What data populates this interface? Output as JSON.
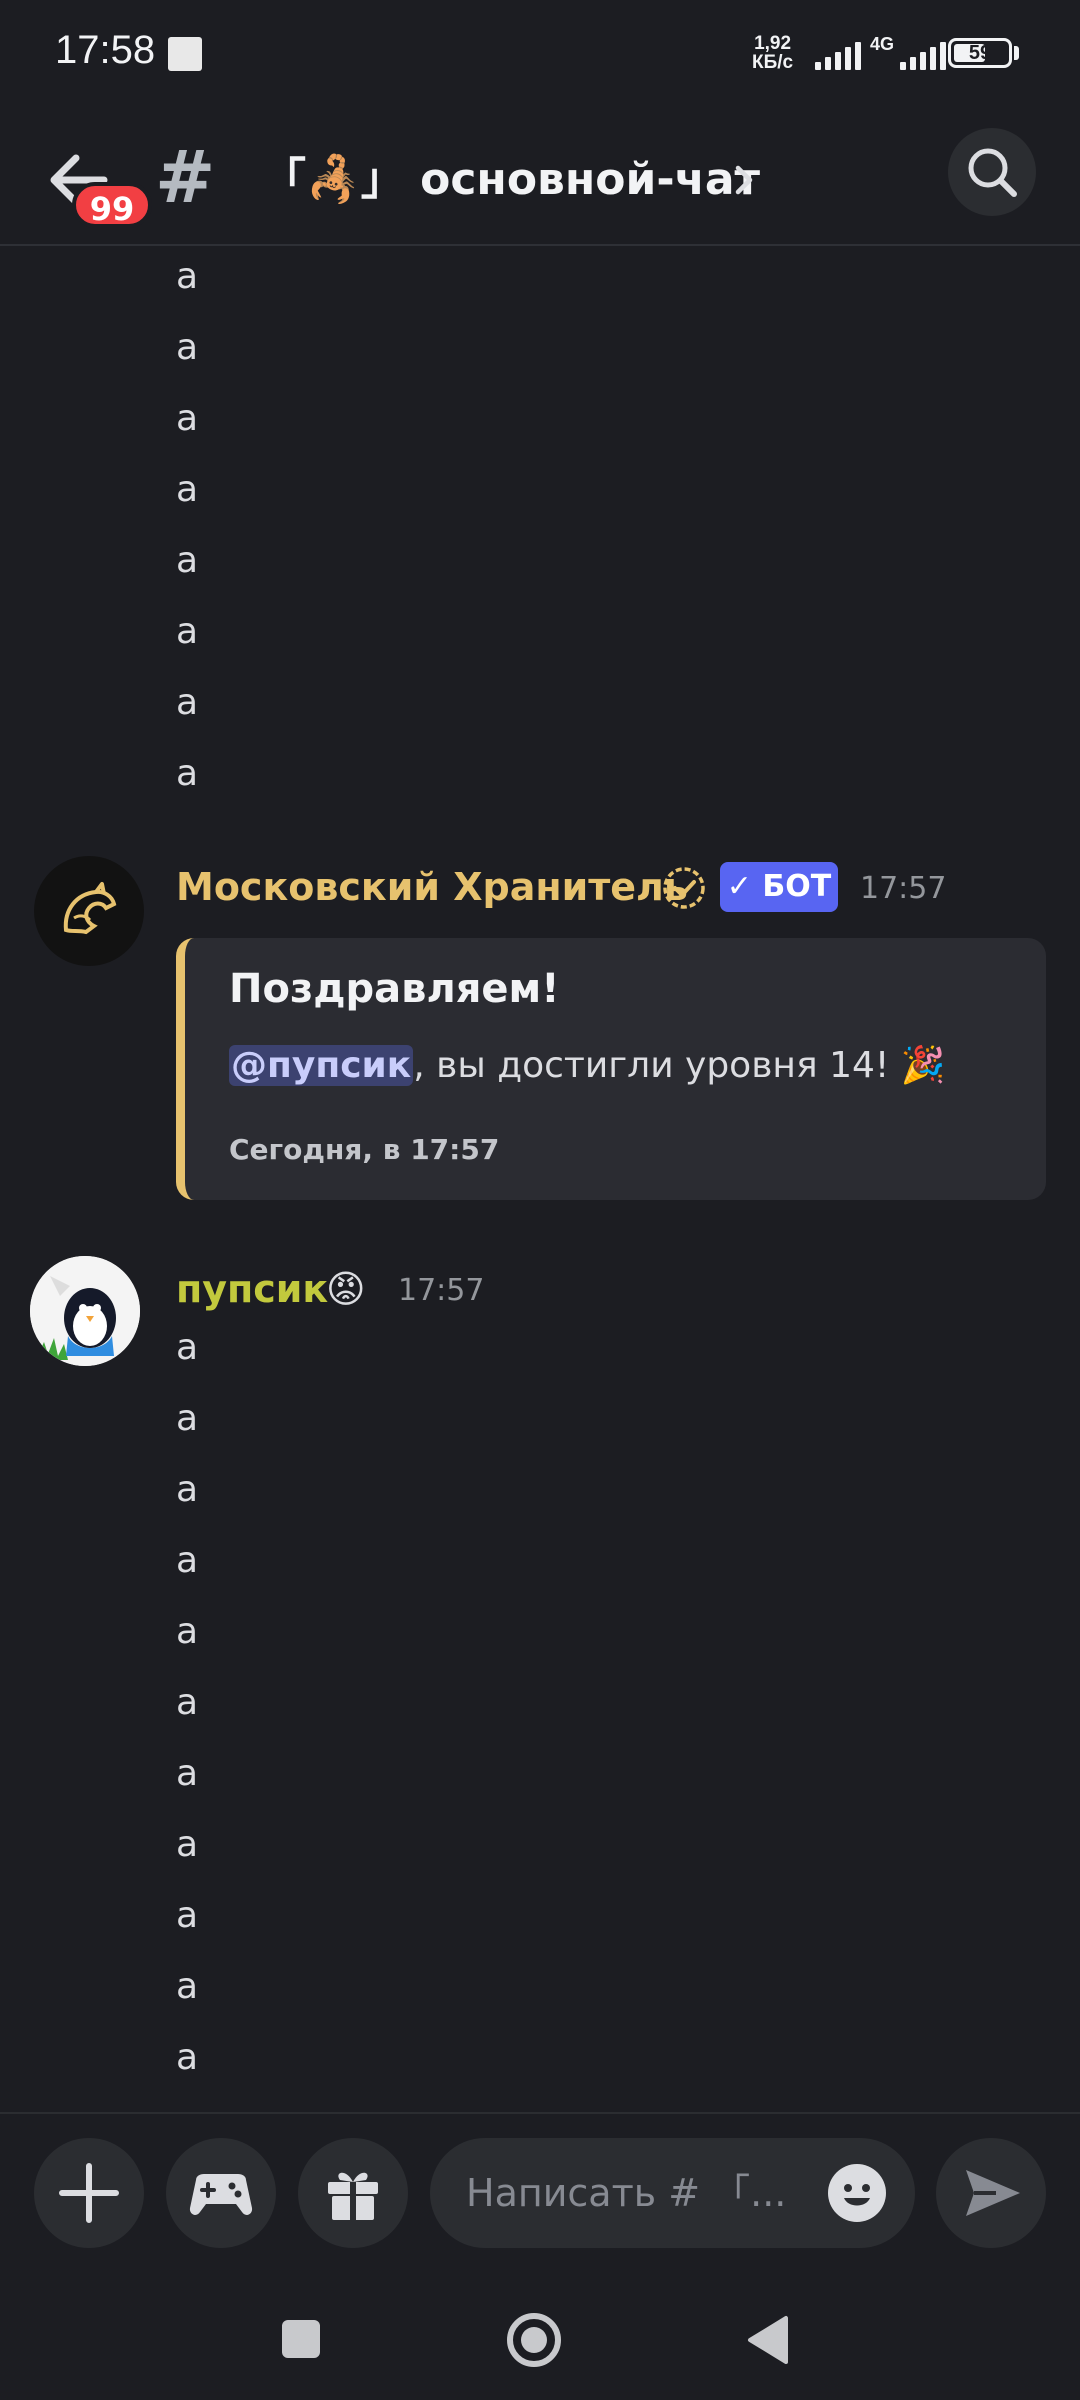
{
  "status_bar": {
    "time": "17:58",
    "net_speed_value": "1,92",
    "net_speed_unit": "КБ/с",
    "network_type": "4G",
    "battery": "59",
    "battery_fraction": 0.59
  },
  "header": {
    "unread_count": "99",
    "channel_name": "「🦂」 основной-чат"
  },
  "messages": {
    "top_lines": [
      "а",
      "а",
      "а",
      "а",
      "а",
      "а",
      "а",
      "а"
    ],
    "bot_message": {
      "author": "Московский Хранитель",
      "badge": "✓ БОТ",
      "time": "17:57",
      "embed": {
        "title": "Поздравляем!",
        "mention": "@пупсик",
        "text": ", вы достигли уровня 14! 🎉",
        "footer": "Сегодня, в 17:57"
      }
    },
    "user_message": {
      "author": "пупсик",
      "author_emoji": "😡",
      "time": "17:57",
      "lines": [
        "а",
        "а",
        "а",
        "а",
        "а",
        "а",
        "а",
        "а",
        "а",
        "а",
        "а"
      ]
    }
  },
  "composer": {
    "placeholder": "Написать # 「..."
  },
  "colors": {
    "background": "#1c1d22",
    "bot_author": "#e7c26e",
    "user_author": "#c2c93d",
    "bot_badge": "#5865f2",
    "unread_badge": "#f23f43"
  },
  "icons": [
    "back-arrow-icon",
    "hash-icon",
    "chevron-right-icon",
    "search-icon",
    "verified-icon",
    "plus-icon",
    "gamepad-icon",
    "gift-icon",
    "emoji-icon",
    "send-icon",
    "nav-square-icon",
    "nav-home-icon",
    "nav-back-icon"
  ]
}
